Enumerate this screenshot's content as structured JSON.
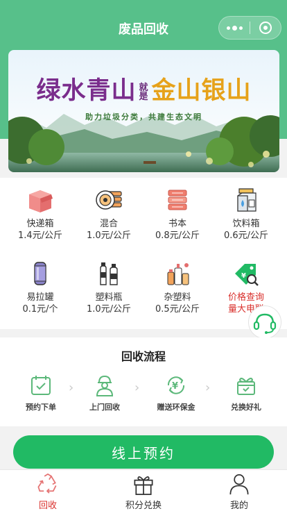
{
  "header": {
    "title": "废品回收"
  },
  "banner": {
    "headline_part1": "绿水青山",
    "headline_mid": "就是",
    "headline_part2": "金山银山",
    "subtitle": "助力垃圾分类，共建生态文明"
  },
  "categories": [
    {
      "name": "快递箱",
      "price": "1.4元/公斤",
      "icon": "box-icon"
    },
    {
      "name": "混合",
      "price": "1.0元/公斤",
      "icon": "mixed-icon"
    },
    {
      "name": "书本",
      "price": "0.8元/公斤",
      "icon": "books-icon"
    },
    {
      "name": "饮料箱",
      "price": "0.6元/公斤",
      "icon": "carton-icon"
    },
    {
      "name": "易拉罐",
      "price": "0.1元/个",
      "icon": "can-icon"
    },
    {
      "name": "塑料瓶",
      "price": "1.0元/公斤",
      "icon": "bottle-icon"
    },
    {
      "name": "杂塑料",
      "price": "0.5元/公斤",
      "icon": "plastics-icon"
    },
    {
      "name": "价格查询",
      "price": "量大电联",
      "icon": "price-tag-icon",
      "highlight": true
    }
  ],
  "process": {
    "title": "回收流程",
    "steps": [
      "预约下单",
      "上门回收",
      "赠送环保金",
      "兑换好礼"
    ]
  },
  "reserve_button": "线上预约",
  "tabs": [
    {
      "label": "回收",
      "icon": "recycle-icon",
      "active": true
    },
    {
      "label": "积分兑换",
      "icon": "gift-icon",
      "active": false
    },
    {
      "label": "我的",
      "icon": "user-icon",
      "active": false
    }
  ],
  "colors": {
    "header_green": "#57c08a",
    "button_green": "#21ba64",
    "active_red": "#d9302c"
  }
}
